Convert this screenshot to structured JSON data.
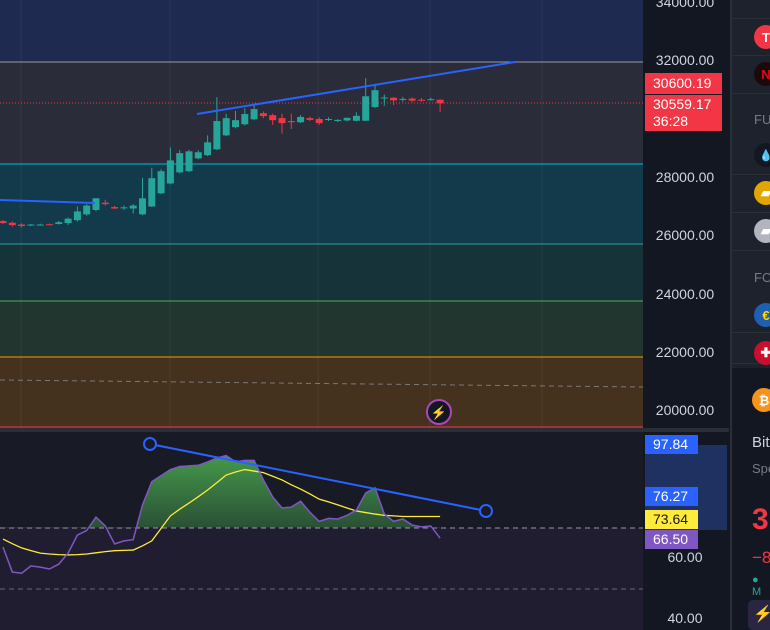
{
  "price_axis": {
    "ticks": [
      "34000.00",
      "32000.00",
      "28000.00",
      "26000.00",
      "24000.00",
      "22000.00",
      "20000.00"
    ],
    "tick_values": [
      34000,
      32000,
      28000,
      26000,
      24000,
      22000,
      20000
    ],
    "last_price_label": "30600.19",
    "current_price": "30559.17",
    "countdown": "36:28"
  },
  "rsi_axis": {
    "ticks": [
      "60.00",
      "40.00"
    ],
    "tick_values": [
      60,
      40
    ],
    "labels": [
      {
        "value": "97.84",
        "color": "#2962ff",
        "text_color": "#ffffff"
      },
      {
        "value": "76.27",
        "color": "#2962ff",
        "text_color": "#ffffff"
      },
      {
        "value": "73.64",
        "color": "#ffeb3b",
        "text_color": "#131722"
      },
      {
        "value": "66.50",
        "color": "#7e57c2",
        "text_color": "#ffffff"
      }
    ]
  },
  "colors": {
    "up": "#26a69a",
    "down": "#f23645",
    "rsi": "#7e57c2",
    "rsi_ma": "#ffeb3b",
    "trendline": "#2962ff"
  },
  "chart_data": {
    "type": "candlestick",
    "candles": [
      [
        26520,
        26560,
        26420,
        26450
      ],
      [
        26460,
        26500,
        26330,
        26380
      ],
      [
        26400,
        26440,
        26300,
        26350
      ],
      [
        26380,
        26420,
        26350,
        26400
      ],
      [
        26400,
        26430,
        26370,
        26400
      ],
      [
        26410,
        26430,
        26380,
        26390
      ],
      [
        26420,
        26520,
        26400,
        26480
      ],
      [
        26450,
        26640,
        26380,
        26600
      ],
      [
        26550,
        27020,
        26500,
        26850
      ],
      [
        26750,
        27100,
        26700,
        27050
      ],
      [
        26900,
        27300,
        26860,
        27300
      ],
      [
        27150,
        27250,
        27050,
        27100
      ],
      [
        27000,
        27040,
        26930,
        26950
      ],
      [
        26980,
        27050,
        26900,
        26990
      ],
      [
        26950,
        27100,
        26780,
        27050
      ],
      [
        26750,
        28000,
        26720,
        27300
      ],
      [
        27020,
        28350,
        27000,
        27990
      ],
      [
        27470,
        28300,
        27440,
        28230
      ],
      [
        27810,
        29040,
        27780,
        28600
      ],
      [
        28190,
        28950,
        28150,
        28850
      ],
      [
        28230,
        28960,
        28200,
        28910
      ],
      [
        28670,
        28950,
        28640,
        28880
      ],
      [
        28780,
        29460,
        28750,
        29220
      ],
      [
        28980,
        30770,
        28950,
        29950
      ],
      [
        29460,
        30200,
        29430,
        30050
      ],
      [
        29740,
        30300,
        29700,
        29980
      ],
      [
        29840,
        30390,
        29800,
        30190
      ],
      [
        30010,
        30490,
        29980,
        30360
      ],
      [
        30220,
        30280,
        30050,
        30120
      ],
      [
        30150,
        30200,
        29820,
        29980
      ],
      [
        30050,
        30200,
        29520,
        29880
      ],
      [
        29950,
        30200,
        29680,
        29910
      ],
      [
        29910,
        30160,
        29880,
        30090
      ],
      [
        30050,
        30100,
        29950,
        29990
      ],
      [
        30020,
        30080,
        29820,
        29880
      ],
      [
        29990,
        30080,
        29950,
        30020
      ],
      [
        29950,
        30020,
        29920,
        29990
      ],
      [
        29970,
        30070,
        29940,
        30060
      ],
      [
        29960,
        30250,
        29940,
        30130
      ],
      [
        29960,
        31420,
        29950,
        30800
      ],
      [
        30430,
        31230,
        30400,
        31010
      ],
      [
        30750,
        30860,
        30480,
        30760
      ],
      [
        30750,
        30770,
        30500,
        30660
      ],
      [
        30700,
        30780,
        30620,
        30710
      ],
      [
        30720,
        30760,
        30610,
        30650
      ],
      [
        30680,
        30740,
        30620,
        30650
      ],
      [
        30690,
        30750,
        30650,
        30700
      ],
      [
        30680,
        30700,
        30260,
        30559
      ]
    ],
    "rsi": [
      63.6,
      55.4,
      55,
      57.4,
      57,
      56.4,
      58,
      61.6,
      67.5,
      69,
      73.4,
      70.5,
      64.6,
      65.6,
      66,
      77.4,
      85,
      87,
      89,
      90,
      90.2,
      90.4,
      91.5,
      92.8,
      93.6,
      91.5,
      92,
      92,
      85.6,
      80,
      76.4,
      76.7,
      78.6,
      75,
      72,
      73,
      72.8,
      74,
      75.7,
      81.3,
      83,
      74.4,
      72,
      72.8,
      70.8,
      70.2,
      70.5,
      66.5
    ],
    "rsi_ma": [
      66.2,
      64.7,
      63.3,
      62.4,
      61.6,
      61.3,
      61.1,
      61,
      61.1,
      61.3,
      61.7,
      62.1,
      62.4,
      62.5,
      62.6,
      64,
      65.6,
      69.7,
      73.8,
      76,
      78,
      80.1,
      82.3,
      84.7,
      87.2,
      88.2,
      89,
      88.5,
      88,
      86.8,
      85.6,
      84,
      82.6,
      81,
      79.3,
      78.4,
      77.4,
      76.4,
      75.4,
      74.9,
      74.4,
      74,
      73.8,
      73.6,
      73.6,
      73.6,
      73.6,
      73.6
    ],
    "ylim_price": [
      19500,
      34100
    ],
    "ylim_rsi": [
      36,
      100
    ]
  },
  "sidebar": {
    "items": [
      {
        "name": "tesla",
        "glyph": "T",
        "bg": "#f23645",
        "fg": "#ffffff"
      },
      {
        "name": "netflix",
        "glyph": "N",
        "bg": "#1a0a0a",
        "fg": "#e50914"
      }
    ],
    "section_futures": "FUT",
    "futures": [
      {
        "name": "crude-oil",
        "glyph": "💧",
        "bg": "#131722",
        "fg": "#ffffff"
      },
      {
        "name": "gold",
        "glyph": "▰",
        "bg": "#e2a600",
        "fg": "#ffffff"
      },
      {
        "name": "silver",
        "glyph": "▰",
        "bg": "#b2b5be",
        "fg": "#ffffff"
      }
    ],
    "section_forex": "FO",
    "forex": [
      {
        "name": "eurusd",
        "glyph": "€",
        "bg": "#1e5fb4",
        "fg": "#ffd700"
      },
      {
        "name": "gbpusd",
        "glyph": "✚",
        "bg": "#c8102e",
        "fg": "#ffffff"
      }
    ],
    "detail": {
      "symbol_glyph": "₿",
      "name": "Bit",
      "type": "Spe",
      "price": "3",
      "change": "−8",
      "status": "M"
    }
  }
}
